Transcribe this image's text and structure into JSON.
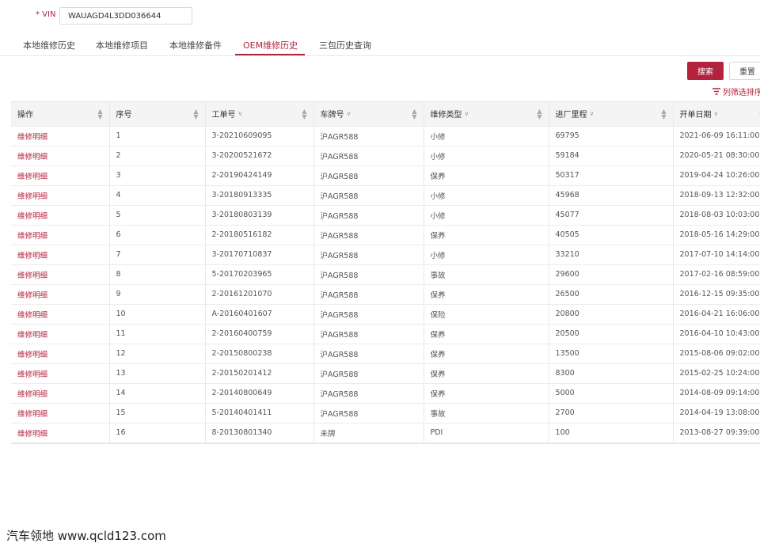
{
  "vin": {
    "label": "* VIN",
    "value": "WAUAGD4L3DD036644"
  },
  "tabs": [
    {
      "label": "本地维修历史",
      "active": false
    },
    {
      "label": "本地维修项目",
      "active": false
    },
    {
      "label": "本地维修备件",
      "active": false
    },
    {
      "label": "OEM维修历史",
      "active": true
    },
    {
      "label": "三包历史查询",
      "active": false
    }
  ],
  "toolbar": {
    "search_label": "搜索",
    "reset_label": "重置",
    "column_filter_label": "列筛选排序"
  },
  "table": {
    "columns": [
      "操作",
      "序号",
      "工单号",
      "车牌号",
      "维修类型",
      "进厂里程",
      "开单日期"
    ],
    "rows": [
      [
        "维修明细",
        "1",
        "3-20210609095",
        "沪AGR588",
        "小修",
        "69795",
        "2021-06-09 16:11:00"
      ],
      [
        "维修明细",
        "2",
        "3-20200521672",
        "沪AGR588",
        "小修",
        "59184",
        "2020-05-21 08:30:00"
      ],
      [
        "维修明细",
        "3",
        "2-20190424149",
        "沪AGR588",
        "保养",
        "50317",
        "2019-04-24 10:26:00"
      ],
      [
        "维修明细",
        "4",
        "3-20180913335",
        "沪AGR588",
        "小修",
        "45968",
        "2018-09-13 12:32:00"
      ],
      [
        "维修明细",
        "5",
        "3-20180803139",
        "沪AGR588",
        "小修",
        "45077",
        "2018-08-03 10:03:00"
      ],
      [
        "维修明细",
        "6",
        "2-20180516182",
        "沪AGR588",
        "保养",
        "40505",
        "2018-05-16 14:29:00"
      ],
      [
        "维修明细",
        "7",
        "3-20170710837",
        "沪AGR588",
        "小修",
        "33210",
        "2017-07-10 14:14:00"
      ],
      [
        "维修明细",
        "8",
        "5-20170203965",
        "沪AGR588",
        "事故",
        "29600",
        "2017-02-16 08:59:00"
      ],
      [
        "维修明细",
        "9",
        "2-20161201070",
        "沪AGR588",
        "保养",
        "26500",
        "2016-12-15 09:35:00"
      ],
      [
        "维修明细",
        "10",
        "A-20160401607",
        "沪AGR588",
        "保险",
        "20800",
        "2016-04-21 16:06:00"
      ],
      [
        "维修明细",
        "11",
        "2-20160400759",
        "沪AGR588",
        "保养",
        "20500",
        "2016-04-10 10:43:00"
      ],
      [
        "维修明细",
        "12",
        "2-20150800238",
        "沪AGR588",
        "保养",
        "13500",
        "2015-08-06 09:02:00"
      ],
      [
        "维修明细",
        "13",
        "2-20150201412",
        "沪AGR588",
        "保养",
        "8300",
        "2015-02-25 10:24:00"
      ],
      [
        "维修明细",
        "14",
        "2-20140800649",
        "沪AGR588",
        "保养",
        "5000",
        "2014-08-09 09:14:00"
      ],
      [
        "维修明细",
        "15",
        "5-20140401411",
        "沪AGR588",
        "事故",
        "2700",
        "2014-04-19 13:08:00"
      ],
      [
        "维修明细",
        "16",
        "8-20130801340",
        "未牌",
        "PDI",
        "100",
        "2013-08-27 09:39:00"
      ]
    ]
  },
  "watermark": "汽车领地 www.qcld123.com",
  "colors": {
    "accent": "#b3233d",
    "header_bg": "#f4f4f4"
  }
}
